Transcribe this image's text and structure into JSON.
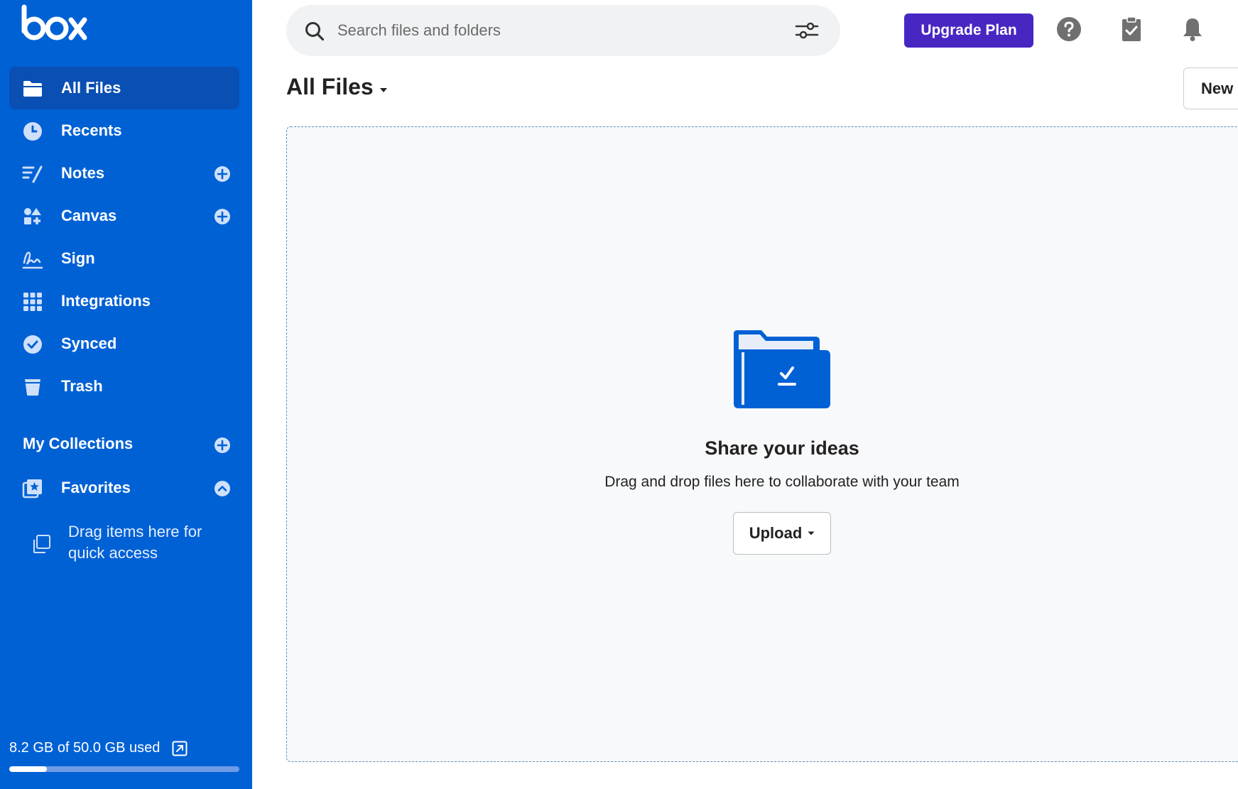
{
  "app": {
    "name": "box"
  },
  "sidebar": {
    "items": [
      {
        "label": "All Files",
        "icon": "folder-icon",
        "active": true,
        "has_add": false
      },
      {
        "label": "Recents",
        "icon": "clock-icon",
        "active": false,
        "has_add": false
      },
      {
        "label": "Notes",
        "icon": "notes-icon",
        "active": false,
        "has_add": true
      },
      {
        "label": "Canvas",
        "icon": "canvas-icon",
        "active": false,
        "has_add": true
      },
      {
        "label": "Sign",
        "icon": "signature-icon",
        "active": false,
        "has_add": false
      },
      {
        "label": "Integrations",
        "icon": "grid-icon",
        "active": false,
        "has_add": false
      },
      {
        "label": "Synced",
        "icon": "check-circle-icon",
        "active": false,
        "has_add": false
      },
      {
        "label": "Trash",
        "icon": "trash-icon",
        "active": false,
        "has_add": false
      }
    ],
    "collections_title": "My Collections",
    "favorites": {
      "label": "Favorites",
      "icon": "favorites-star-icon",
      "expanded": true,
      "hint": "Drag items here for quick access"
    },
    "storage": {
      "text": "8.2 GB of 50.0 GB used",
      "used_gb": 8.2,
      "total_gb": 50.0,
      "used_fraction": 0.164
    }
  },
  "topbar": {
    "search_placeholder": "Search files and folders",
    "search_value": "",
    "upgrade_label": "Upgrade Plan",
    "icons": [
      "help-icon",
      "tasks-icon",
      "bell-icon"
    ]
  },
  "main": {
    "title": "All Files",
    "new_button_label": "New",
    "empty_state": {
      "title": "Share your ideas",
      "subtitle": "Drag and drop files here to collaborate with your team",
      "upload_label": "Upload"
    }
  },
  "colors": {
    "sidebar_bg": "#0061d5",
    "sidebar_active": "#0a4fb3",
    "upgrade_bg": "#4826c2",
    "dropzone_bg": "#f8f9fb"
  }
}
